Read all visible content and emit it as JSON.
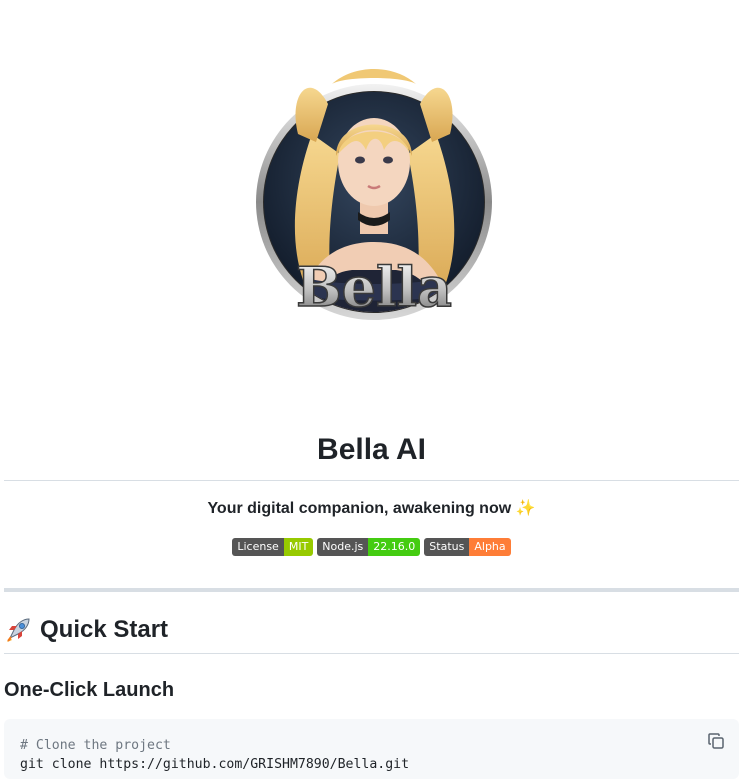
{
  "header": {
    "avatar_text": "Bella",
    "title": "Bella AI",
    "tagline": "Your digital companion, awakening now",
    "tagline_emoji": "✨"
  },
  "badges": [
    {
      "label": "License",
      "value": "MIT",
      "color": "#97ca00"
    },
    {
      "label": "Node.js",
      "value": "22.16.0",
      "color": "#4c1"
    },
    {
      "label": "Status",
      "value": "Alpha",
      "color": "#fe7d37"
    }
  ],
  "quick_start": {
    "emoji_icon": "rocket-icon",
    "heading": "Quick Start",
    "subheading": "One-Click Launch",
    "code_comment": "# Clone the project",
    "code_command": "git clone https://github.com/GRISHM7890/Bella.git",
    "copy_icon": "copy-icon"
  },
  "colors": {
    "text": "#1f2328",
    "rule": "#d8dee4",
    "code_bg": "#f6f8fa"
  }
}
